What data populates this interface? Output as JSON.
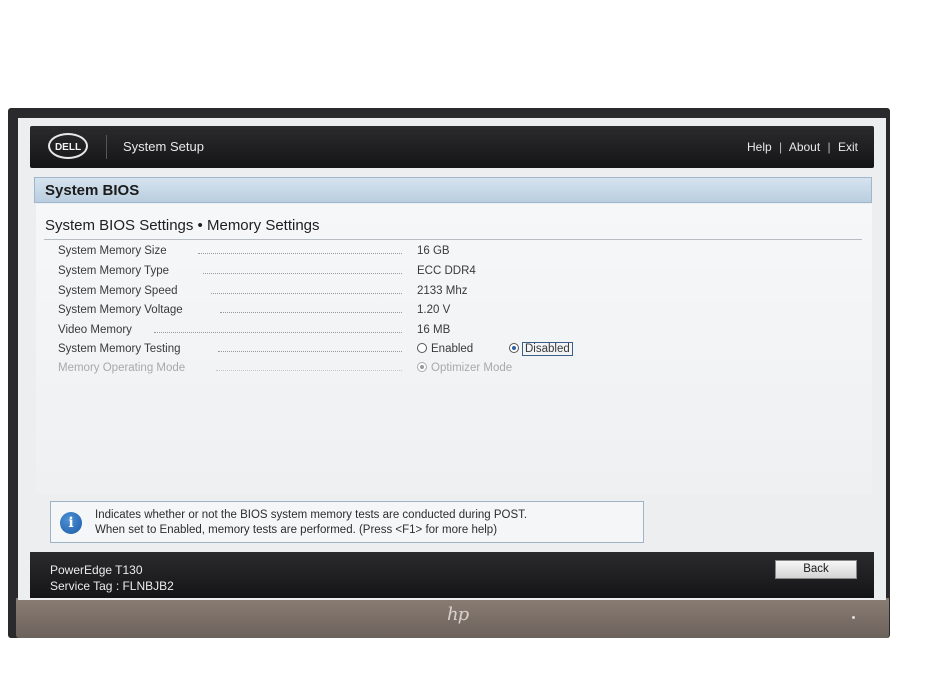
{
  "header": {
    "logo_text": "DELL",
    "app_title": "System Setup",
    "links": [
      "Help",
      "About",
      "Exit"
    ],
    "separator": "|"
  },
  "section": {
    "title": "System BIOS"
  },
  "page": {
    "title": "System BIOS Settings • Memory Settings"
  },
  "settings": [
    {
      "label": "System Memory Size",
      "value": "16 GB"
    },
    {
      "label": "System Memory Type",
      "value": "ECC DDR4"
    },
    {
      "label": "System Memory Speed",
      "value": "2133 Mhz"
    },
    {
      "label": "System Memory Voltage",
      "value": "1.20 V"
    },
    {
      "label": "Video Memory",
      "value": "16 MB"
    },
    {
      "label": "System Memory Testing",
      "options": [
        "Enabled",
        "Disabled"
      ],
      "selected": "Disabled"
    },
    {
      "label": "Memory Operating Mode",
      "options": [
        "Optimizer Mode"
      ],
      "selected": "Optimizer Mode",
      "disabled": true
    }
  ],
  "help": {
    "icon": "info-icon",
    "line1": "Indicates whether or not the BIOS system memory tests are conducted during POST.",
    "line2": "When set to Enabled, memory tests are performed. (Press <F1> for more help)"
  },
  "footer": {
    "model": "PowerEdge T130",
    "service_tag": "Service Tag : FLNBJB2",
    "back_label": "Back"
  },
  "monitor": {
    "brand_logo": "hp"
  }
}
